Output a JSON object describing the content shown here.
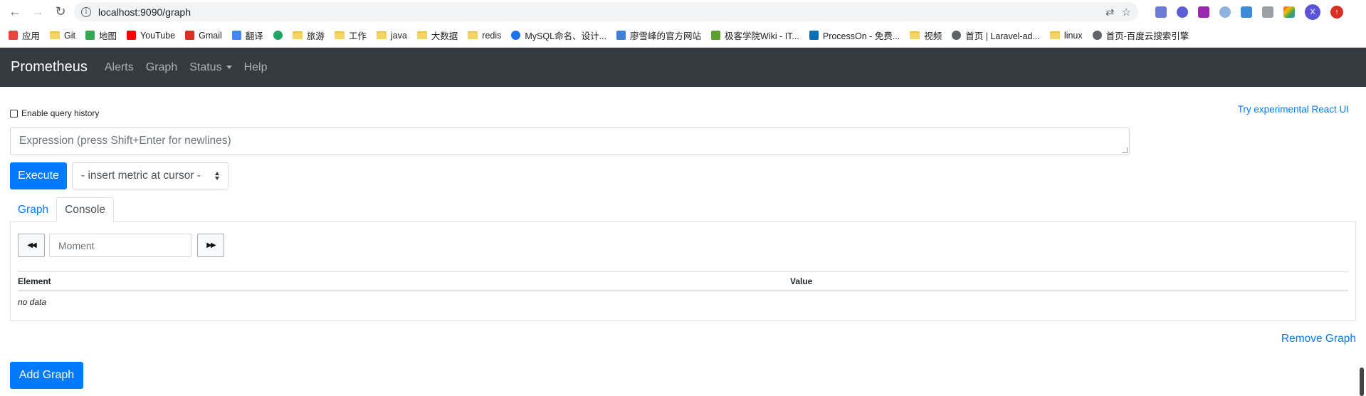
{
  "browser": {
    "url": "localhost:9090/graph",
    "profile_initial": "X",
    "bookmarks": [
      {
        "label": "应用",
        "icon": "apps-grid-icon",
        "color": "#e8453c"
      },
      {
        "label": "Git",
        "icon": "folder-icon",
        "color": "#f6d365"
      },
      {
        "label": "地图",
        "icon": "maps-icon",
        "color": "#34a853"
      },
      {
        "label": "YouTube",
        "icon": "youtube-icon",
        "color": "#ff0000"
      },
      {
        "label": "Gmail",
        "icon": "gmail-icon",
        "color": "#d93025"
      },
      {
        "label": "翻译",
        "icon": "translate-icon",
        "color": "#4285f4"
      },
      {
        "label": "",
        "icon": "c-logo-icon",
        "color": "#1fa463"
      },
      {
        "label": "旅游",
        "icon": "folder-icon",
        "color": "#f6d365"
      },
      {
        "label": "工作",
        "icon": "folder-icon",
        "color": "#f6d365"
      },
      {
        "label": "java",
        "icon": "folder-icon",
        "color": "#f6d365"
      },
      {
        "label": "大数据",
        "icon": "folder-icon",
        "color": "#f6d365"
      },
      {
        "label": "redis",
        "icon": "folder-icon",
        "color": "#f6d365"
      },
      {
        "label": "MySQL命名、设计...",
        "icon": "globe-icon",
        "color": "#1a73e8"
      },
      {
        "label": "廖雪峰的官方网站",
        "icon": "rocket-icon",
        "color": "#3f7fd8"
      },
      {
        "label": "极客学院Wiki - IT...",
        "icon": "jike-icon",
        "color": "#5aa02c"
      },
      {
        "label": "ProcessOn - 免费...",
        "icon": "processon-icon",
        "color": "#0a6fb7"
      },
      {
        "label": "视频",
        "icon": "folder-icon",
        "color": "#f6d365"
      },
      {
        "label": "首页 | Laravel-ad...",
        "icon": "globe-icon",
        "color": "#5f6368"
      },
      {
        "label": "linux",
        "icon": "folder-icon",
        "color": "#f6d365"
      },
      {
        "label": "首页-百度云搜索引擎",
        "icon": "globe-icon",
        "color": "#5f6368"
      }
    ]
  },
  "navbar": {
    "brand": "Prometheus",
    "links": [
      "Alerts",
      "Graph",
      "Status",
      "Help"
    ]
  },
  "page": {
    "history_label": "Enable query history",
    "react_link": "Try experimental React UI",
    "expression_placeholder": "Expression (press Shift+Enter for newlines)",
    "execute_label": "Execute",
    "metric_select": "- insert metric at cursor -",
    "tabs": [
      "Graph",
      "Console"
    ],
    "active_tab": "Console",
    "moment_placeholder": "Moment",
    "table_headers": [
      "Element",
      "Value"
    ],
    "no_data": "no data",
    "remove_graph": "Remove Graph",
    "add_graph": "Add Graph"
  },
  "colors": {
    "primary": "#007bff",
    "navbar_bg": "#343a40"
  }
}
